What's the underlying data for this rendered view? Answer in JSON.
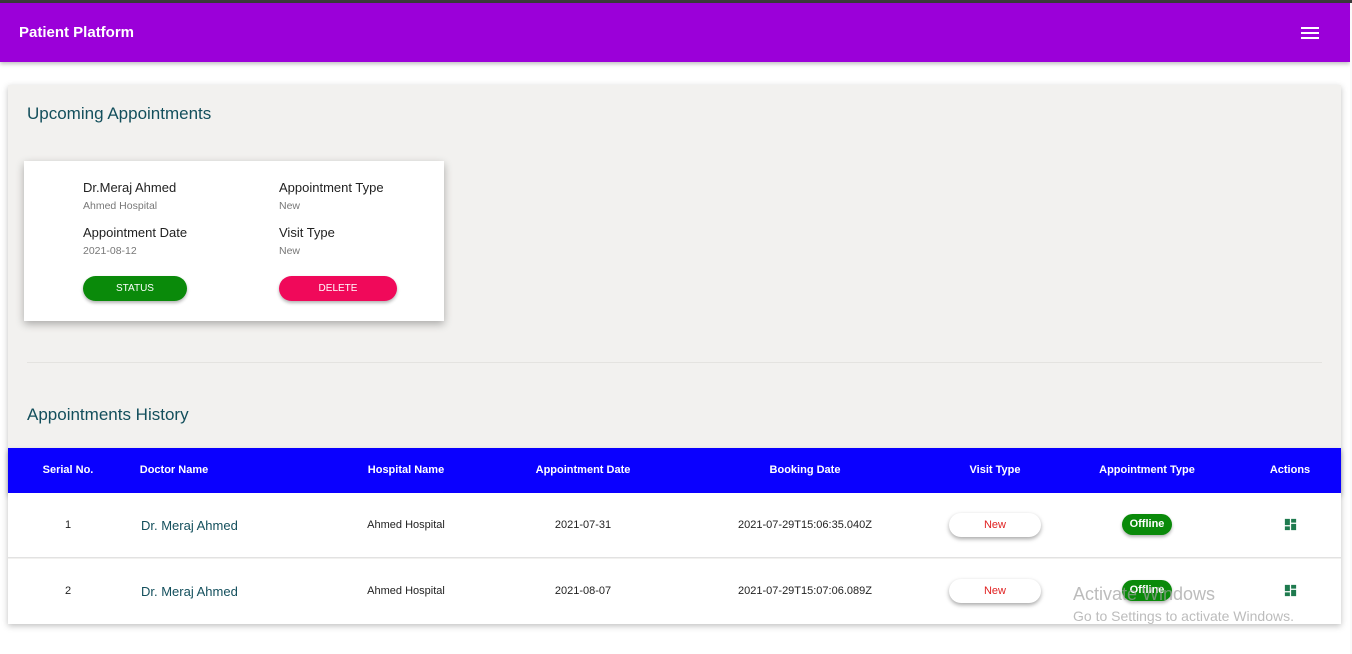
{
  "app": {
    "title": "Patient Platform",
    "menu_icon": "hamburger-menu-icon"
  },
  "upcoming": {
    "title": "Upcoming Appointments",
    "card": {
      "doctor": "Dr.Meraj Ahmed",
      "hospital": "Ahmed Hospital",
      "appt_type_label": "Appointment Type",
      "appt_type_value": "New",
      "appt_date_label": "Appointment Date",
      "appt_date_value": "2021-08-12",
      "visit_type_label": "Visit Type",
      "visit_type_value": "New",
      "status_button": "STATUS",
      "delete_button": "DELETE"
    }
  },
  "history": {
    "title": "Appointments History",
    "columns": [
      "Serial No.",
      "Doctor Name",
      "Hospital Name",
      "Appointment Date",
      "Booking Date",
      "Visit Type",
      "Appointment Type",
      "Actions"
    ],
    "rows": [
      {
        "serial": "1",
        "doctor": "Dr. Meraj Ahmed",
        "hospital": "Ahmed Hospital",
        "appt_date": "2021-07-31",
        "booking_date": "2021-07-29T15:06:35.040Z",
        "visit_type": "New",
        "appt_type": "Offline"
      },
      {
        "serial": "2",
        "doctor": "Dr. Meraj Ahmed",
        "hospital": "Ahmed Hospital",
        "appt_date": "2021-08-07",
        "booking_date": "2021-07-29T15:07:06.089Z",
        "visit_type": "New",
        "appt_type": "Offline"
      }
    ],
    "action_icon": "dashboard-icon"
  },
  "watermark": {
    "line1": "Activate Windows",
    "line2": "Go to Settings to activate Windows."
  },
  "colors": {
    "appbar": "#9b00d9",
    "table_header": "#0a00ff",
    "status_green": "#0a8a0a",
    "delete_pink": "#f0095a",
    "title_teal": "#134f5c"
  }
}
